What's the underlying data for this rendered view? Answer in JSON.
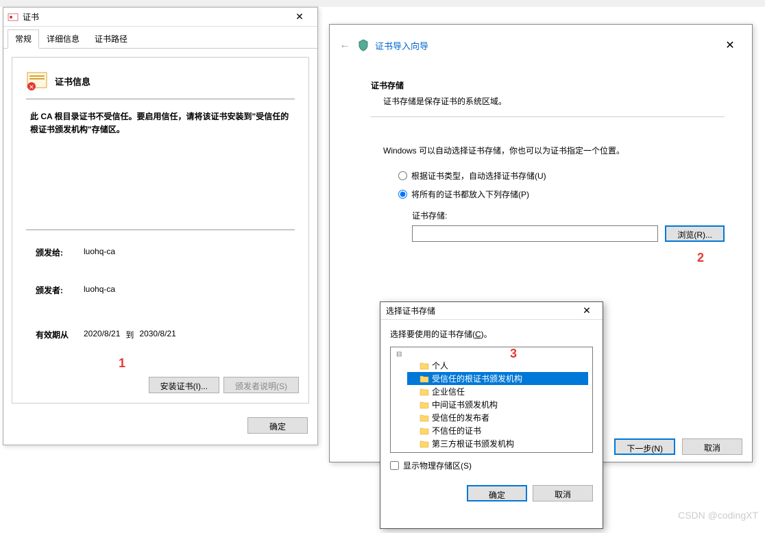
{
  "cert_dialog": {
    "title": "证书",
    "tabs": [
      "常规",
      "详细信息",
      "证书路径"
    ],
    "info_title": "证书信息",
    "warning": "此 CA 根目录证书不受信任。要启用信任，请将该证书安装到\"受信任的根证书颁发机构\"存储区。",
    "issued_to_label": "颁发给:",
    "issued_to_value": "luohq-ca",
    "issued_by_label": "颁发者:",
    "issued_by_value": "luohq-ca",
    "validity_label": "有效期从",
    "validity_from": "2020/8/21",
    "validity_to_word": "到",
    "validity_to": "2030/8/21",
    "install_button": "安装证书(I)...",
    "issuer_statement_button": "颁发者说明(S)",
    "ok_button": "确定"
  },
  "wizard": {
    "title": "证书导入向导",
    "section_title": "证书存储",
    "section_desc": "证书存储是保存证书的系统区域。",
    "hint": "Windows 可以自动选择证书存储，你也可以为证书指定一个位置。",
    "radio_auto": "根据证书类型，自动选择证书存储(U)",
    "radio_manual": "将所有的证书都放入下列存储(P)",
    "store_label": "证书存储:",
    "store_value": "",
    "browse_button": "浏览(R)...",
    "next_button": "下一步(N)",
    "cancel_button": "取消"
  },
  "select_store": {
    "title": "选择证书存储",
    "hint_prefix": "选择要使用的证书存储(",
    "hint_underline": "C",
    "hint_suffix": ")。",
    "tree_items": [
      "个人",
      "受信任的根证书颁发机构",
      "企业信任",
      "中间证书颁发机构",
      "受信任的发布者",
      "不信任的证书",
      "第三方根证书颁发机构"
    ],
    "selected_index": 1,
    "show_physical": "显示物理存储区(S)",
    "ok_button": "确定",
    "cancel_button": "取消"
  },
  "markers": {
    "m1": "1",
    "m2": "2",
    "m3": "3"
  },
  "watermark": "CSDN @codingXT"
}
